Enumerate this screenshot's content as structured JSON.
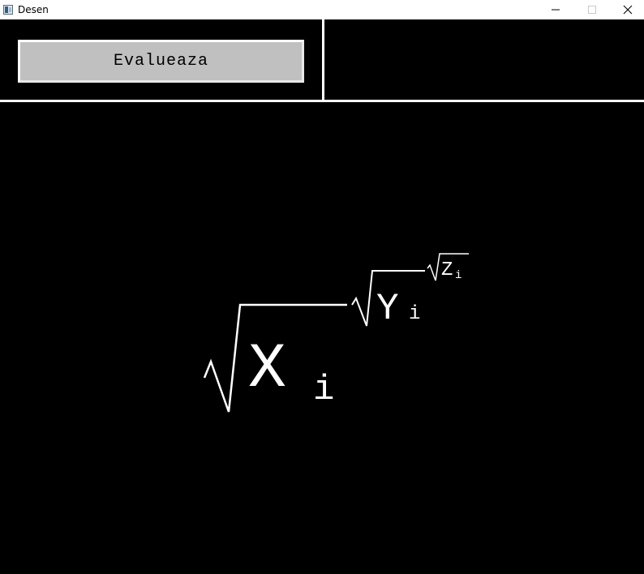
{
  "window": {
    "title": "Desen",
    "icon": "app-window-icon",
    "controls": [
      "minimize-icon",
      "maximize-icon",
      "close-icon"
    ]
  },
  "toolbar": {
    "evaluate_label": "Evalueaza"
  },
  "formula": {
    "x_base": "X",
    "x_sub": "i",
    "y_base": "Y",
    "y_sub": "i",
    "z_base": "Z",
    "z_sub": "i"
  },
  "colors": {
    "background": "#000000",
    "foreground": "#ffffff",
    "button_face": "#c0c0c0"
  }
}
